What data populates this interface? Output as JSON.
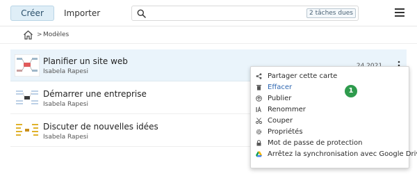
{
  "toolbar": {
    "create_label": "Créer",
    "import_label": "Importer"
  },
  "search": {
    "value": "",
    "placeholder": "",
    "due_badge": "2 tâches dues"
  },
  "breadcrumb": {
    "separator": ">",
    "current": "Modèles"
  },
  "maps": [
    {
      "title": "Planifier un site web",
      "owner": "Isabela Rapesi",
      "date": "… 24 2021",
      "selected": true
    },
    {
      "title": "Démarrer une entreprise",
      "owner": "Isabela Rapesi"
    },
    {
      "title": "Discuter de nouvelles idées",
      "owner": "Isabela Rapesi"
    }
  ],
  "context_menu": {
    "items": [
      {
        "label": "Partager cette carte",
        "icon": "share-icon"
      },
      {
        "label": "Effacer",
        "icon": "trash-icon",
        "highlight": true
      },
      {
        "label": "Publier",
        "icon": "publish-icon"
      },
      {
        "label": "Renommer",
        "icon": "rename-icon"
      },
      {
        "label": "Couper",
        "icon": "cut-icon"
      },
      {
        "label": "Propriétés",
        "icon": "gear-icon"
      },
      {
        "label": "Mot de passe de protection",
        "icon": "lock-icon"
      },
      {
        "label": "Arrêtez la synchronisation avec Google Drive",
        "icon": "google-drive-icon"
      }
    ]
  },
  "step_badge": "1",
  "colors": {
    "accent": "#2f67b1",
    "selected_row": "#eaf4fb",
    "create_button": "#dfeef7",
    "badge_green": "#2e9b4d"
  }
}
